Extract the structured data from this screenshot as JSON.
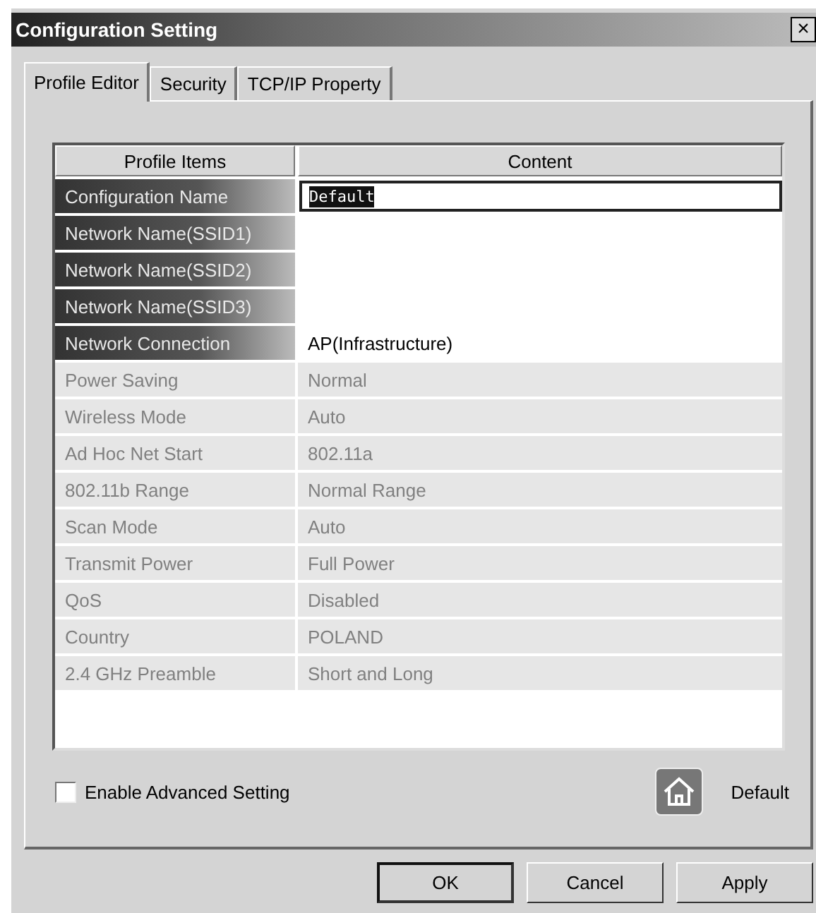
{
  "window": {
    "title": "Configuration Setting",
    "close": "×"
  },
  "tabs": [
    {
      "label": "Profile Editor",
      "selected": true
    },
    {
      "label": "Security",
      "selected": false
    },
    {
      "label": "TCP/IP Property",
      "selected": false
    }
  ],
  "table": {
    "columns": [
      "Profile Items",
      "Content"
    ],
    "rows": [
      {
        "item": "Configuration Name",
        "content": "Default",
        "disabled": false,
        "focused": true
      },
      {
        "item": "Network Name(SSID1)",
        "disabled": false,
        "focused": false
      },
      {
        "item": "Network Name(SSID2)",
        "disabled": false,
        "focused": false
      },
      {
        "item": "Network Name(SSID3)",
        "disabled": false,
        "focused": false
      },
      {
        "item": "Network Connection",
        "content": "AP(Infrastructure)",
        "disabled": false,
        "focused": false
      },
      {
        "item": "Power Saving",
        "content": "Normal",
        "disabled": true,
        "focused": false
      },
      {
        "item": "Wireless Mode",
        "content": "Auto",
        "disabled": true,
        "focused": false
      },
      {
        "item": "Ad Hoc Net Start",
        "content": "802.11a",
        "disabled": true,
        "focused": false
      },
      {
        "item": "802.11b Range",
        "content": "Normal Range",
        "disabled": true,
        "focused": false
      },
      {
        "item": "Scan Mode",
        "content": "Auto",
        "disabled": true,
        "focused": false
      },
      {
        "item": "Transmit Power",
        "content": "Full Power",
        "disabled": true,
        "focused": false
      },
      {
        "item": "QoS",
        "content": "Disabled",
        "disabled": true,
        "focused": false
      },
      {
        "item": "Country",
        "content": "POLAND",
        "disabled": true,
        "focused": false
      },
      {
        "item": "2.4 GHz Preamble",
        "content": "Short and Long",
        "disabled": true,
        "focused": false
      }
    ]
  },
  "advanced": {
    "label": "Enable Advanced Setting",
    "checked": false
  },
  "default_button": {
    "label": "Default"
  },
  "buttons": [
    {
      "label": "OK",
      "default": true
    },
    {
      "label": "Cancel",
      "default": false
    },
    {
      "label": "Apply",
      "default": false
    }
  ]
}
